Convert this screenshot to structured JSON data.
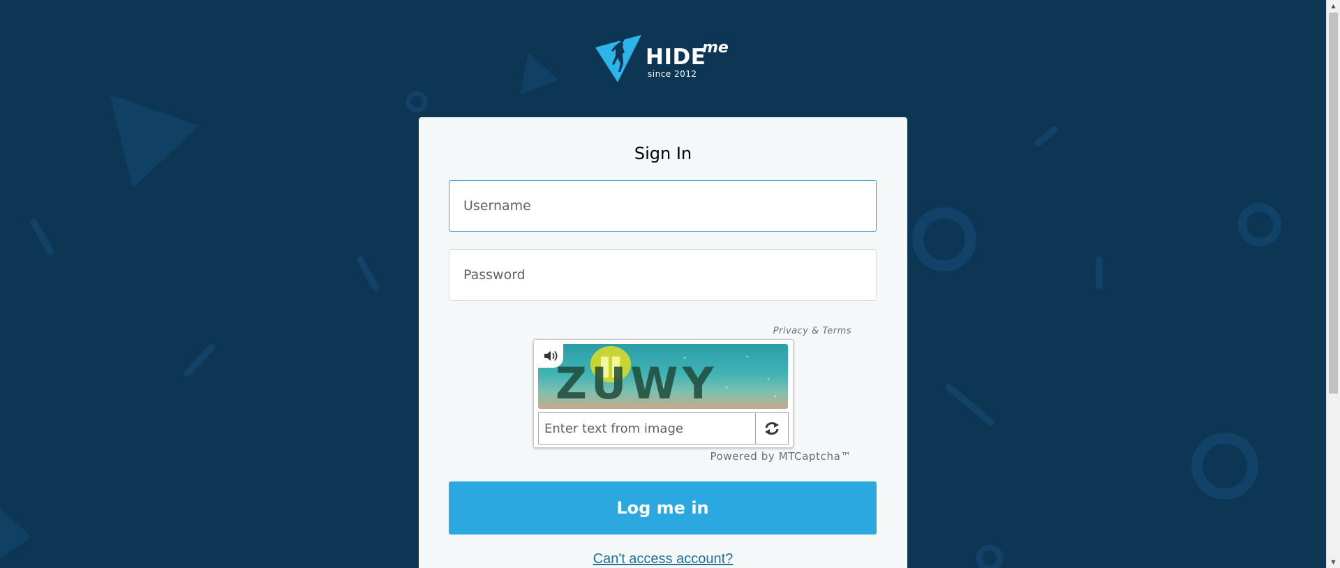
{
  "brand": {
    "logo_text": "HIDE",
    "logo_suffix": "me",
    "tagline": "since 2012"
  },
  "form": {
    "title": "Sign In",
    "username_placeholder": "Username",
    "password_placeholder": "Password",
    "submit_label": "Log me in",
    "forgot_link": "Can't access account?"
  },
  "captcha": {
    "privacy_link": "Privacy & Terms",
    "input_placeholder": "Enter text from image",
    "challenge_text": "ZUWY",
    "powered_by": "Powered by MTCaptcha™",
    "audio_icon": "speaker-icon",
    "refresh_icon": "refresh-icon"
  },
  "colors": {
    "background": "#0d3554",
    "card": "#f5f8f8",
    "accent": "#2ca8e0",
    "link": "#1f6e9e"
  }
}
